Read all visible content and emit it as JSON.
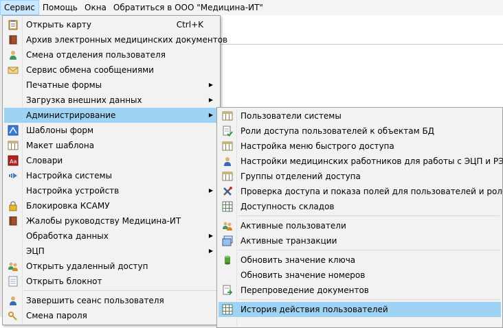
{
  "menubar": {
    "items": [
      "Сервис",
      "Помощь",
      "Окна",
      "Обратиться в ООО \"Медицина-ИТ\""
    ]
  },
  "main_menu": {
    "items": [
      {
        "label": "Открыть карту",
        "shortcut": "Ctrl+K",
        "icon": "clipboard-icon"
      },
      {
        "label": "Архив электронных медицинских документов",
        "icon": "book-icon"
      },
      {
        "label": "Смена отделения пользователя",
        "icon": "user-icon"
      },
      {
        "label": "Сервис обмена сообщениями",
        "icon": "envelope-icon"
      },
      {
        "label": "Печатные формы",
        "submenu": true
      },
      {
        "label": "Загрузка внешних данных",
        "submenu": true
      },
      {
        "label": "Администрирование",
        "submenu": true,
        "highlighted": true
      },
      {
        "label": "Шаблоны форм",
        "icon": "template-icon"
      },
      {
        "label": "Макет шаблона",
        "icon": "table-icon"
      },
      {
        "label": "Словари",
        "icon": "dictionary-icon"
      },
      {
        "label": "Настройка системы",
        "icon": "arrow-settings-icon"
      },
      {
        "label": "Настройка устройств",
        "submenu": true
      },
      {
        "label": "Блокировка КСАМУ",
        "icon": "lock-icon"
      },
      {
        "label": "Жалобы руководству Медицина-ИТ",
        "icon": "book-icon"
      },
      {
        "label": "Обработка данных",
        "submenu": true
      },
      {
        "label": "ЭЦП",
        "submenu": true
      },
      {
        "label": "Открыть удаленный доступ",
        "icon": "users-icon"
      },
      {
        "label": "Открыть блокнот",
        "icon": "notepad-icon"
      },
      {
        "label": "Завершить сеанс пользователя",
        "icon": "user-icon"
      },
      {
        "label": "Смена пароля",
        "icon": "key-icon"
      }
    ]
  },
  "sub_menu": {
    "items": [
      {
        "label": "Пользователи системы",
        "icon": "table-icon"
      },
      {
        "label": "Роли доступа пользователей к объектам БД",
        "icon": "check-doc-icon"
      },
      {
        "label": "Настройка меню быстрого доступа",
        "icon": "table-icon"
      },
      {
        "label": "Настройки медицинских работников для работы с ЭЦП и РЭМД",
        "icon": "user-icon"
      },
      {
        "label": "Группы отделений доступа",
        "icon": "table-icon"
      },
      {
        "label": "Проверка доступа и показа полей для пользователей и ролей",
        "icon": "tools-icon"
      },
      {
        "label": "Доступность складов",
        "icon": "grid-icon"
      },
      {
        "label": "Активные пользователи",
        "icon": "users-icon"
      },
      {
        "label": "Активные транзакции",
        "icon": "window-icon"
      },
      {
        "label": "Обновить значение ключа",
        "icon": "cylinder-icon"
      },
      {
        "label": "Обновить значение номеров"
      },
      {
        "label": "Перепроведение документов",
        "icon": "doc-arrow-icon"
      },
      {
        "label": "История действия пользователей",
        "icon": "grid-icon",
        "highlighted": true
      }
    ]
  },
  "colors": {
    "menu_bg": "#f2f2f2",
    "highlight": "#9fd3f3",
    "menubar_active": "#cce8ff"
  }
}
